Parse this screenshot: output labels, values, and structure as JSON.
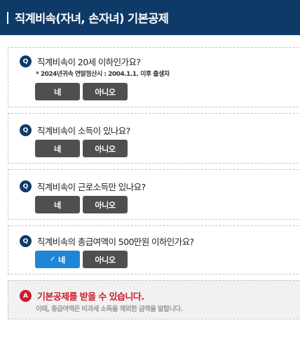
{
  "header": {
    "title": "직계비속(자녀, 손자녀) 기본공제"
  },
  "questions": [
    {
      "badge": "Q",
      "text": "직계비속이 20세 이하인가요?",
      "note": "* 2024년귀속 연말정산시 : 2004.1.1. 이후 출생자",
      "yes_label": "네",
      "no_label": "아니오",
      "selected": "none"
    },
    {
      "badge": "Q",
      "text": "직계비속이 소득이 있나요?",
      "yes_label": "네",
      "no_label": "아니오",
      "selected": "none"
    },
    {
      "badge": "Q",
      "text": "직계비속이 근로소득만 있나요?",
      "yes_label": "네",
      "no_label": "아니오",
      "selected": "none"
    },
    {
      "badge": "Q",
      "text": "직계비속의 총급여액이 500만원 이하인가요?",
      "yes_label": "네",
      "no_label": "아니오",
      "selected": "yes"
    }
  ],
  "answer": {
    "badge": "A",
    "title": "기본공제를 받을 수 있습니다.",
    "note": "이때, 총급여액은 비과세 소득을 제외한 금액을 말합니다."
  },
  "colors": {
    "header_bg": "#0e3a67",
    "button_bg": "#4f4f4f",
    "button_selected_bg": "#1e86d6",
    "answer_red": "#c81e2e"
  },
  "icons": {
    "selected_mark": "check-icon"
  }
}
